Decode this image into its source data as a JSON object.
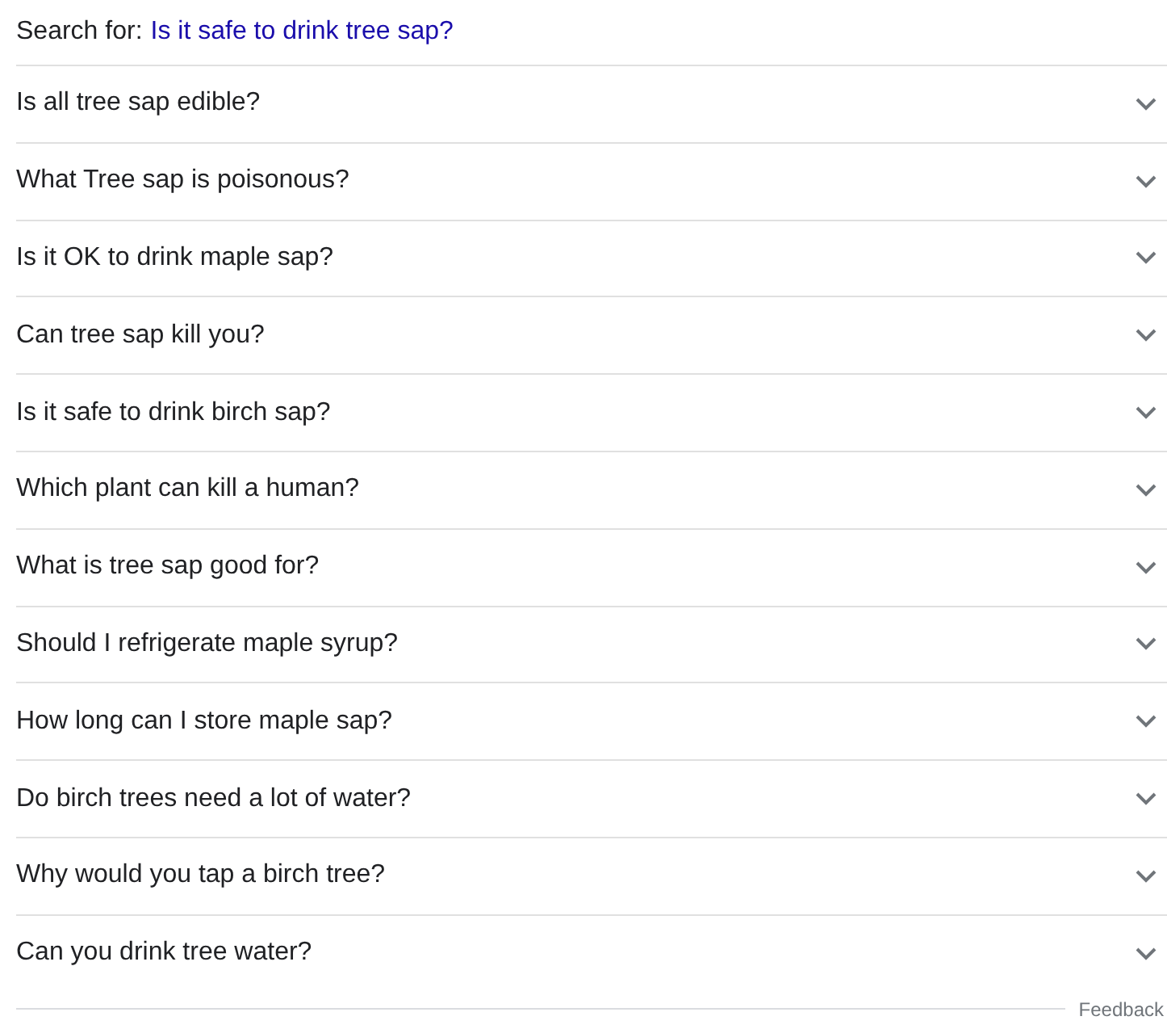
{
  "search": {
    "label": "Search for:",
    "query": "Is it safe to drink tree sap?"
  },
  "questions": [
    {
      "text": "Is all tree sap edible?",
      "expanded": false
    },
    {
      "text": "What Tree sap is poisonous?",
      "expanded": false
    },
    {
      "text": "Is it OK to drink maple sap?",
      "expanded": false
    },
    {
      "text": "Can tree sap kill you?",
      "expanded": false
    },
    {
      "text": "Is it safe to drink birch sap?",
      "expanded": false
    },
    {
      "text": "Which plant can kill a human?",
      "expanded": false
    },
    {
      "text": "What is tree sap good for?",
      "expanded": false
    },
    {
      "text": "Should I refrigerate maple syrup?",
      "expanded": false
    },
    {
      "text": "How long can I store maple sap?",
      "expanded": false
    },
    {
      "text": "Do birch trees need a lot of water?",
      "expanded": false
    },
    {
      "text": "Why would you tap a birch tree?",
      "expanded": false
    },
    {
      "text": "Can you drink tree water?",
      "expanded": false
    }
  ],
  "feedback": "Feedback"
}
